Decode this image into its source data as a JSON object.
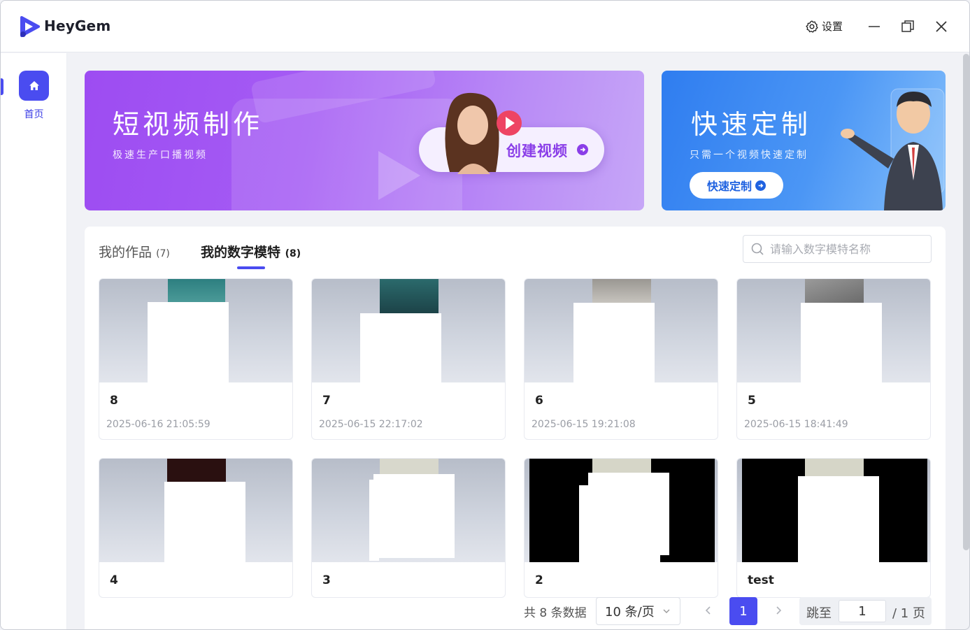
{
  "app": {
    "name": "HeyGem"
  },
  "header": {
    "settings_label": "设置"
  },
  "sidebar": {
    "home_label": "首页"
  },
  "banner_left": {
    "title": "短视频制作",
    "subtitle": "极速生产口播视频",
    "button_label": "创建视频"
  },
  "banner_right": {
    "title": "快速定制",
    "subtitle": "只需一个视频快速定制",
    "button_label": "快速定制"
  },
  "tabs": [
    {
      "label": "我的作品",
      "count": "(7)",
      "active": false
    },
    {
      "label": "我的数字模特",
      "count": "(8)",
      "active": true
    }
  ],
  "search": {
    "placeholder": "请输入数字模特名称",
    "value": ""
  },
  "models": [
    {
      "name": "8",
      "date": "2025-06-16 21:05:59"
    },
    {
      "name": "7",
      "date": "2025-06-15 22:17:02"
    },
    {
      "name": "6",
      "date": "2025-06-15 19:21:08"
    },
    {
      "name": "5",
      "date": "2025-06-15 18:41:49"
    },
    {
      "name": "4",
      "date": ""
    },
    {
      "name": "3",
      "date": ""
    },
    {
      "name": "2",
      "date": ""
    },
    {
      "name": "test",
      "date": ""
    }
  ],
  "pagination": {
    "total_label": "共 8 条数据",
    "page_size_label": "10 条/页",
    "current_page": "1",
    "jump_label": "跳至",
    "jump_value": "1",
    "total_pages_label": "/ 1 页"
  },
  "colors": {
    "accent": "#4a4cf0",
    "banner_left": "#9d4cf2",
    "banner_right": "#2f7df0"
  },
  "icons": [
    "heygem-logo-icon",
    "gear-icon",
    "minimize-icon",
    "restore-icon",
    "close-icon",
    "home-icon",
    "play-icon",
    "arrow-right-circle-icon",
    "search-icon",
    "chevron-down-icon",
    "chevron-left-icon",
    "chevron-right-icon"
  ]
}
